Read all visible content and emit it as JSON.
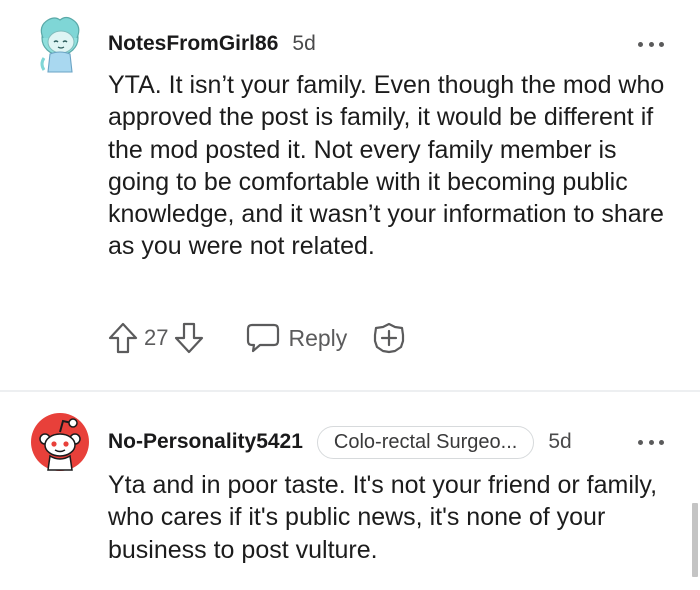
{
  "comments": [
    {
      "username": "NotesFromGirl86",
      "age": "5d",
      "body": "YTA. It isn’t your family. Even though the mod who approved the post is family, it would be different if the mod posted it. Not every family member is going to be comfortable with it becoming public knowledge, and it wasn’t your information to share as you were not related.",
      "score": "27",
      "reply_label": "Reply",
      "avatar_icon": "snoo-avatar-teal-icon"
    },
    {
      "username": "No-Personality5421",
      "flair": "Colo-rectal Surgeo...",
      "age": "5d",
      "body": "Yta and in poor taste. It's not your friend or family, who cares if it's public news, it's none of your business to post vulture.",
      "avatar_icon": "snoo-avatar-default-icon"
    }
  ],
  "colors": {
    "text": "#1a1a1b",
    "muted": "#5b5b5c",
    "divider": "#edeff1",
    "default_avatar_red": "#e8403a",
    "teal_avatar": "#7fd6d6"
  },
  "icons": {
    "more": "more-options-icon",
    "upvote": "upvote-arrow-icon",
    "downvote": "downvote-arrow-icon",
    "reply": "reply-bubble-icon",
    "award": "award-plus-icon"
  }
}
